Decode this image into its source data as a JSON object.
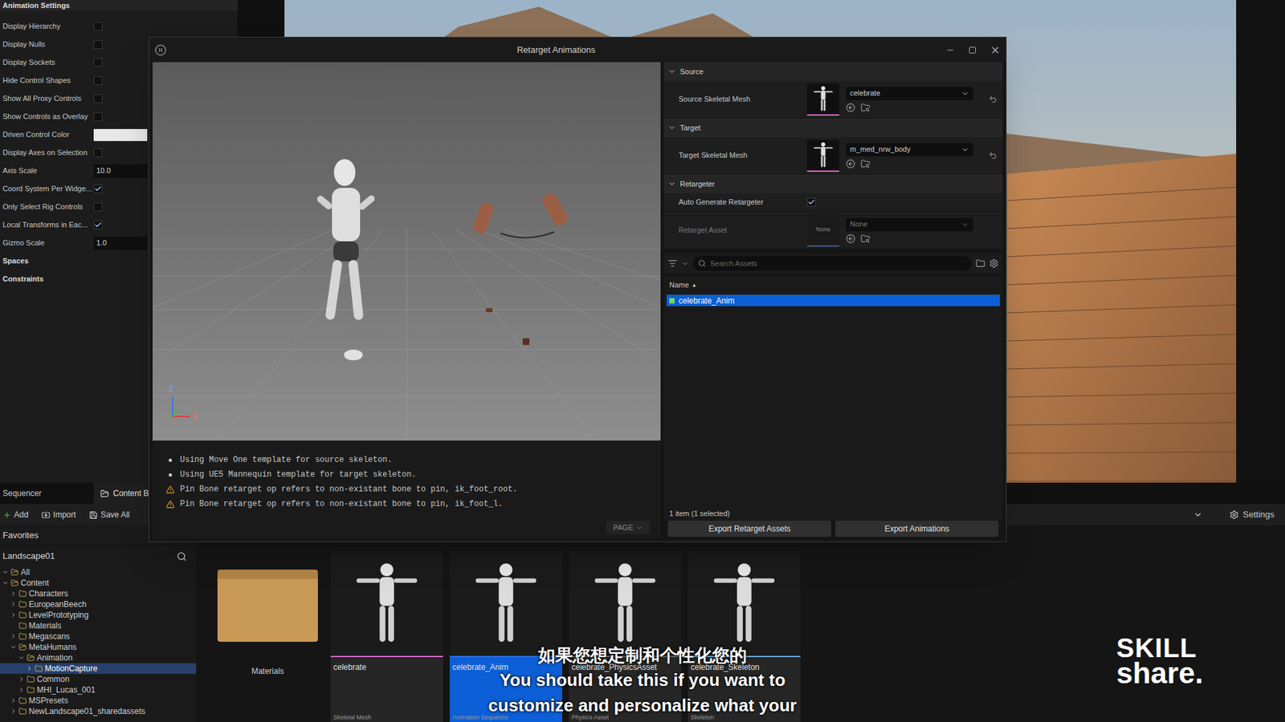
{
  "editor": {
    "settings_panel": {
      "title": "Animation Settings",
      "rows": [
        {
          "label": "Display Hierarchy",
          "kind": "checkbox",
          "checked": false
        },
        {
          "label": "Display Nulls",
          "kind": "checkbox",
          "checked": false
        },
        {
          "label": "Display Sockets",
          "kind": "checkbox",
          "checked": false
        },
        {
          "label": "Hide Control Shapes",
          "kind": "checkbox",
          "checked": false
        },
        {
          "label": "Show All Proxy Controls",
          "kind": "checkbox",
          "checked": false
        },
        {
          "label": "Show Controls as Overlay",
          "kind": "checkbox",
          "checked": false
        },
        {
          "label": "Driven Control Color",
          "kind": "color",
          "color": "#e8e8e8"
        },
        {
          "label": "Display Axes on Selection",
          "kind": "checkbox",
          "checked": false
        },
        {
          "label": "Axis Scale",
          "kind": "number",
          "value": "10.0"
        },
        {
          "label": "Coord System Per Widge...",
          "kind": "checkbox",
          "checked": true
        },
        {
          "label": "Only Select Rig Controls",
          "kind": "checkbox",
          "checked": false
        },
        {
          "label": "Local Transforms in Eac...",
          "kind": "checkbox",
          "checked": true
        },
        {
          "label": "Gizmo Scale",
          "kind": "number",
          "value": "1.0"
        },
        {
          "label": "Spaces",
          "kind": "section"
        },
        {
          "label": "Constraints",
          "kind": "section"
        }
      ]
    },
    "bottom_tabs": [
      {
        "label": "Sequencer",
        "selected": false
      },
      {
        "label": "Content Browser",
        "selected": true
      }
    ],
    "toolbar": [
      "Add",
      "Import",
      "Save All"
    ],
    "settings_button": "Settings",
    "favorites": "Favorites",
    "path": "Landscape01",
    "tree": [
      {
        "label": "All",
        "depth": 0,
        "expandable": true,
        "expanded": true,
        "selected": false
      },
      {
        "label": "Content",
        "depth": 0,
        "expandable": true,
        "expanded": true,
        "selected": false
      },
      {
        "label": "Characters",
        "depth": 1,
        "expandable": true,
        "expanded": false,
        "selected": false
      },
      {
        "label": "EuropeanBeech",
        "depth": 1,
        "expandable": true,
        "expanded": false,
        "selected": false
      },
      {
        "label": "LevelPrototyping",
        "depth": 1,
        "expandable": true,
        "expanded": false,
        "selected": false
      },
      {
        "label": "Materials",
        "depth": 1,
        "expandable": false,
        "expanded": false,
        "selected": false
      },
      {
        "label": "Megascans",
        "depth": 1,
        "expandable": true,
        "expanded": false,
        "selected": false
      },
      {
        "label": "MetaHumans",
        "depth": 1,
        "expandable": true,
        "expanded": true,
        "selected": false
      },
      {
        "label": "Animation",
        "depth": 2,
        "expandable": true,
        "expanded": true,
        "selected": false
      },
      {
        "label": "MotionCapture",
        "depth": 3,
        "expandable": true,
        "expanded": false,
        "selected": true
      },
      {
        "label": "Common",
        "depth": 2,
        "expandable": true,
        "expanded": false,
        "selected": false
      },
      {
        "label": "MHI_Lucas_001",
        "depth": 2,
        "expandable": true,
        "expanded": false,
        "selected": false
      },
      {
        "label": "MSPresets",
        "depth": 1,
        "expandable": true,
        "expanded": false,
        "selected": false
      },
      {
        "label": "NewLandscape01_sharedassets",
        "depth": 1,
        "expandable": true,
        "expanded": false,
        "selected": false
      }
    ],
    "tiles": [
      {
        "name": "Materials",
        "type": "",
        "kind": "folder",
        "selected": false,
        "color": "#000000"
      },
      {
        "name": "celebrate",
        "type": "Skeletal Mesh",
        "kind": "asset",
        "selected": false,
        "color": "#d46ac8"
      },
      {
        "name": "celebrate_Anim",
        "type": "Animation Sequence",
        "kind": "asset",
        "selected": true,
        "color": "#2b6fe0"
      },
      {
        "name": "celebrate_PhysicsAsset",
        "type": "Physics Asset",
        "kind": "asset",
        "selected": false,
        "color": "#6a6a6a"
      },
      {
        "name": "celebrate_Skeleton",
        "type": "Skeleton",
        "kind": "asset",
        "selected": false,
        "color": "#6aa6d8"
      }
    ]
  },
  "dialog": {
    "title": "Retarget Animations",
    "axes": [
      "Z",
      "X"
    ],
    "sections": [
      {
        "title": "Source",
        "rows": [
          {
            "label": "Source Skeletal Mesh",
            "value": "celebrate",
            "thumb": "",
            "disabled": false,
            "kind": "mesh"
          }
        ]
      },
      {
        "title": "Target",
        "rows": [
          {
            "label": "Target Skeletal Mesh",
            "value": "m_med_nrw_body",
            "thumb": "",
            "disabled": false,
            "kind": "mesh"
          }
        ]
      },
      {
        "title": "Retargeter",
        "rows": [
          {
            "label": "Auto Generate Retargeter",
            "kind": "checkbox",
            "checked": true,
            "disabled": false
          },
          {
            "label": "Retarget Asset",
            "value": "None",
            "thumb": "None",
            "disabled": true,
            "kind": "asset"
          }
        ]
      }
    ],
    "search": {
      "placeholder": "Search Assets"
    },
    "list_header": {
      "label": "Name",
      "sort": "▲"
    },
    "assets": [
      {
        "name": "celebrate_Anim",
        "selected": true
      }
    ],
    "count": "1 item (1 selected)",
    "buttons": [
      "Export Retarget Assets",
      "Export Animations"
    ],
    "log": [
      {
        "kind": "info",
        "text": "Using Move One template for source skeleton."
      },
      {
        "kind": "info",
        "text": "Using UE5 Mannequin template for target skeleton."
      },
      {
        "kind": "warning",
        "text": "Pin Bone retarget op refers to non-existant bone to pin, ik_foot_root."
      },
      {
        "kind": "warning",
        "text": "Pin Bone retarget op refers to non-existant bone to pin, ik_foot_l."
      }
    ],
    "page_button": "PAGE"
  },
  "subtitles": [
    "如果您想定制和个性化您的",
    "You should take this if you want to",
    "customize and personalize what your"
  ],
  "brand": [
    "SKILL",
    "share."
  ]
}
